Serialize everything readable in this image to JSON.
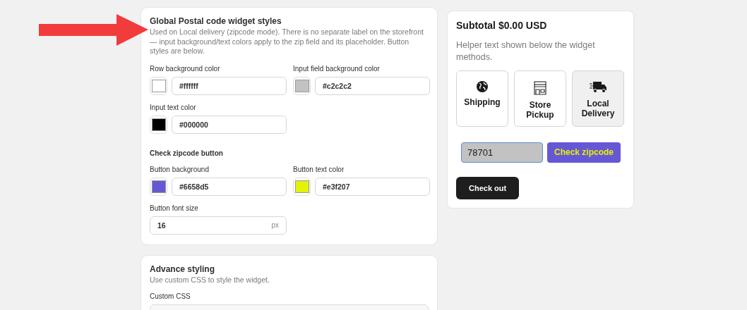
{
  "postal_styles": {
    "title": "Global Postal code widget styles",
    "description": "Used on Local delivery (zipcode mode). There is no separate label on the storefront — input background/text colors apply to the zip field and its placeholder. Button styles are below.",
    "color_fields": [
      {
        "label": "Row background color",
        "value": "#ffffff"
      },
      {
        "label": "Input field background color",
        "value": "#c2c2c2"
      },
      {
        "label": "Input text color",
        "value": "#000000"
      }
    ],
    "button_section": {
      "title": "Check zipcode button",
      "color_fields": [
        {
          "label": "Button background",
          "value": "#6658d5"
        },
        {
          "label": "Button text color",
          "value": "#e3f207"
        }
      ],
      "font_size": {
        "label": "Button font size",
        "value": "16",
        "suffix": "px"
      }
    }
  },
  "advance_styling": {
    "title": "Advance styling",
    "description": "Use custom CSS to style the widget.",
    "custom_css_label": "Custom CSS"
  },
  "preview": {
    "subtotal": "Subtotal $0.00 USD",
    "helper": "Helper text shown below the widget methods.",
    "methods": [
      {
        "kind": "globe",
        "label": "Shipping",
        "selected": false
      },
      {
        "kind": "store",
        "label": "Store Pickup",
        "selected": false
      },
      {
        "kind": "truck",
        "label": "Local Delivery",
        "selected": true
      }
    ],
    "zip_value": "78701",
    "check_button": "Check zipcode",
    "checkout_button": "Check out"
  }
}
